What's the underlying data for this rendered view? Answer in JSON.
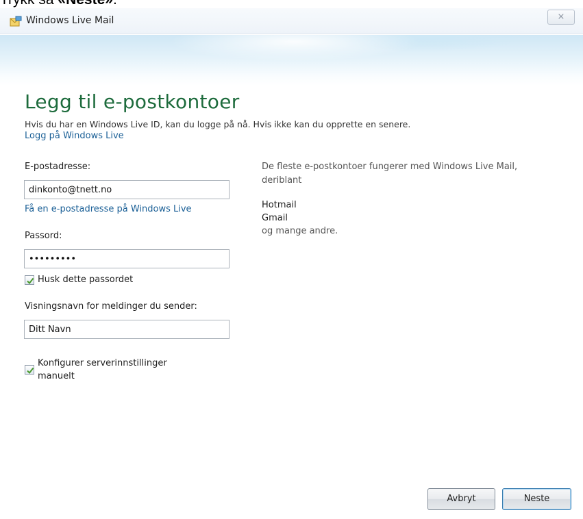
{
  "caption": {
    "prefix": "Trykk så ",
    "bold": "«Neste»",
    "suffix": "."
  },
  "window": {
    "title": "Windows Live Mail",
    "close_glyph": "⨯"
  },
  "heading": "Legg til e-postkontoer",
  "intro": "Hvis du har en Windows Live ID, kan du logge på nå. Hvis ikke kan du opprette en senere.",
  "signin_link": "Logg på Windows Live",
  "form": {
    "email_label": "E-postadresse:",
    "email_value": "dinkonto@tnett.no",
    "get_address_link": "Få en e-postadresse på Windows Live",
    "password_label": "Passord:",
    "password_value": "•••••••••",
    "remember_label": "Husk dette passordet",
    "remember_checked": true,
    "display_name_label": "Visningsnavn for meldinger du sender:",
    "display_name_value": "Ditt Navn",
    "manual_config_label_line1": "Konfigurer serverinnstillinger",
    "manual_config_label_line2": "manuelt",
    "manual_config_checked": true
  },
  "side_info": {
    "line1": "De fleste e-postkontoer fungerer med Windows Live Mail,",
    "line2": "deriblant",
    "providers": [
      "Hotmail",
      "Gmail"
    ],
    "more": "og mange andre."
  },
  "buttons": {
    "cancel": "Avbryt",
    "next": "Neste"
  },
  "colors": {
    "heading": "#1d6b3c",
    "link": "#1a5f96",
    "check": "#4a9a2e"
  },
  "icons": {
    "app": "windows-live-mail-icon",
    "close": "close-icon",
    "check": "checkmark-icon"
  }
}
